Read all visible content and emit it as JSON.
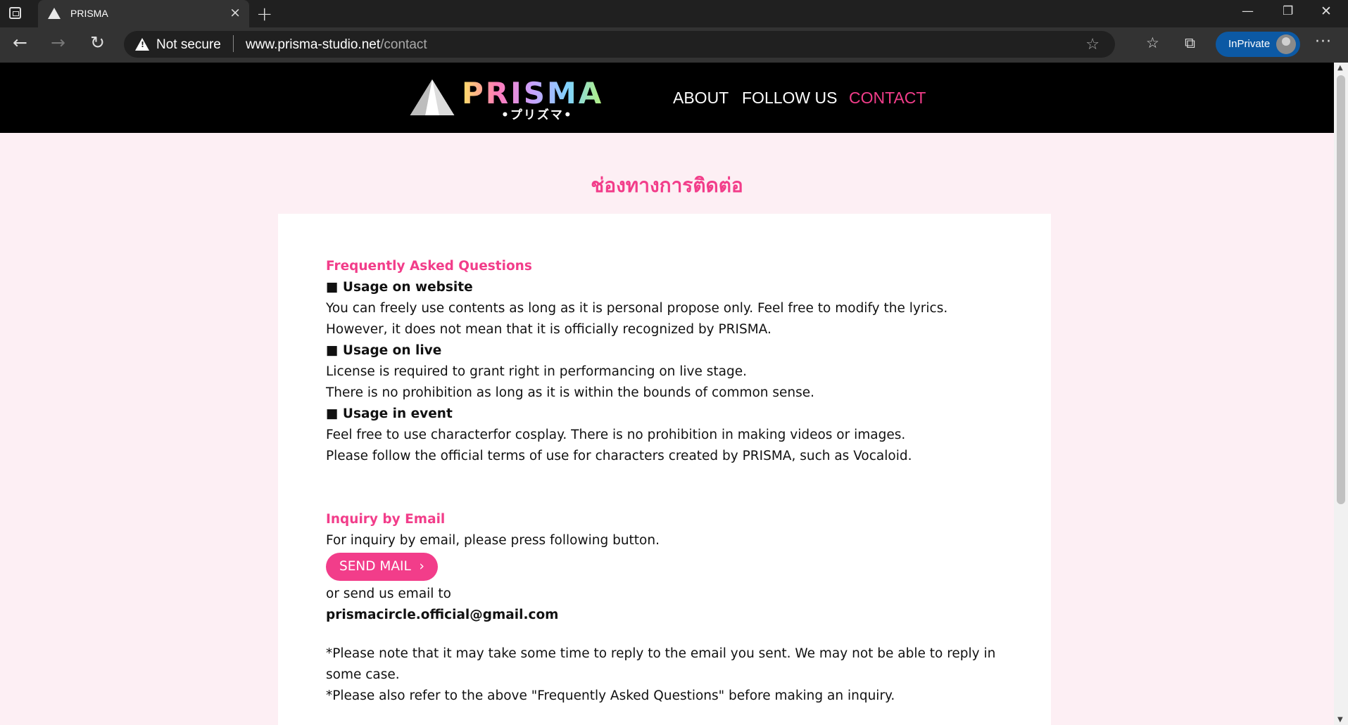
{
  "browser": {
    "tab_title": "PRISMA",
    "tab_close": "×",
    "new_tab": "+",
    "security_label": "Not secure",
    "url_host": "www.prisma-studio.net",
    "url_path": "/contact",
    "inprivate_label": "InPrivate",
    "icons": {
      "tab_actions": "tab-actions-icon",
      "favicon": "prisma-favicon",
      "back": "back-arrow-icon",
      "forward": "forward-arrow-icon",
      "refresh": "refresh-icon",
      "warning": "warning-icon",
      "add_favorite": "star-add-icon",
      "favorites": "favorites-icon",
      "collections": "collections-icon",
      "profile": "avatar",
      "more": "more-icon",
      "minimize": "minimize-icon",
      "maximize": "restore-icon",
      "close": "close-icon"
    }
  },
  "site": {
    "logo_text": "PRISMA",
    "logo_sub": "•プリズマ•",
    "nav": {
      "about": "ABOUT",
      "follow_us": "FOLLOW US",
      "contact": "CONTACT"
    },
    "accent_color": "#f23d8a"
  },
  "page": {
    "heading": "ช่องทางการติดต่อ",
    "faq": {
      "title": "Frequently Asked Questions",
      "website_title": "■ Usage on website",
      "website_line1": "You can freely use contents as long as it is personal propose only. Feel free to modify the lyrics.",
      "website_line2": "However, it does not mean that it is officially recognized by PRISMA.",
      "live_title": "■ Usage on live",
      "live_line1": "License is required to grant right in performancing on live stage.",
      "live_line2": "There is no prohibition as long as it is within the bounds of common sense.",
      "event_title": "■ Usage in event",
      "event_line1": "Feel free to use characterfor cosplay. There is no prohibition in making videos or images.",
      "event_line2": "Please follow the official terms of use for characters created by PRISMA, such as Vocaloid."
    },
    "inquiry": {
      "title": "Inquiry by Email",
      "intro": "For inquiry by email, please press following button.",
      "button_label": "SEND MAIL",
      "button_chevron": "›",
      "alt_text": "or send us email to",
      "email": "prismacircle.official@gmail.com",
      "note1": "*Please note that it may take some time to reply to the email you sent. We may not be able to reply in some case.",
      "note2": "*Please also refer to the above \"Frequently Asked Questions\" before making an inquiry."
    }
  }
}
